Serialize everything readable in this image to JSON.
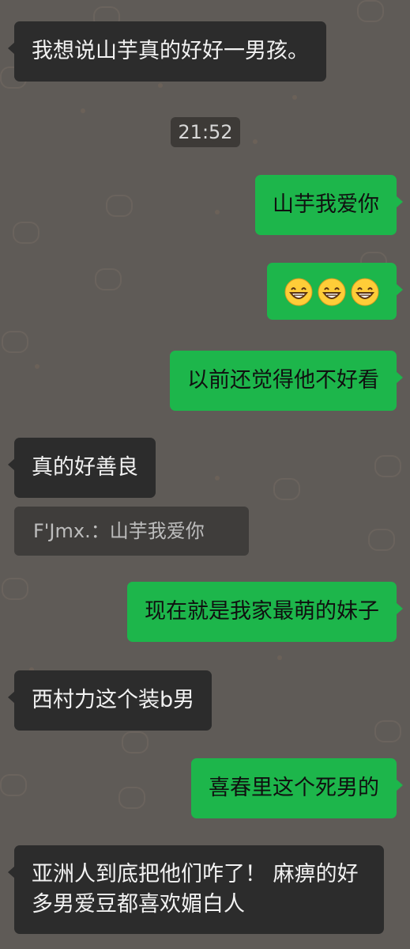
{
  "messages": [
    {
      "text": "我想说山芋真的好好一男孩。"
    },
    {
      "text": "山芋我爱你"
    },
    {
      "emoji": [
        "grinning-face-with-smiling-eyes",
        "grinning-face-with-smiling-eyes",
        "grinning-face-with-smiling-eyes"
      ]
    },
    {
      "text": "以前还觉得他不好看"
    },
    {
      "text": "真的好善良"
    },
    {
      "text": "现在就是我家最萌的妹子"
    },
    {
      "text": "西村力这个装b男"
    },
    {
      "text": "喜春里这个死男的"
    },
    {
      "text": "亚洲人到底把他们咋了！ 麻痹的好多男爱豆都喜欢媚白人"
    }
  ],
  "timestamp": "21:52",
  "quote": {
    "text": "F'Jmx.：山芋我爱你"
  },
  "colors": {
    "background": "#5f5b57",
    "incoming_bubble": "#2c2c2c",
    "outgoing_bubble": "#1db64b",
    "timestamp_bg": "#3d3a37",
    "quote_bg": "#3f3d3b"
  },
  "icons": [
    "grinning-face-with-smiling-eyes"
  ]
}
